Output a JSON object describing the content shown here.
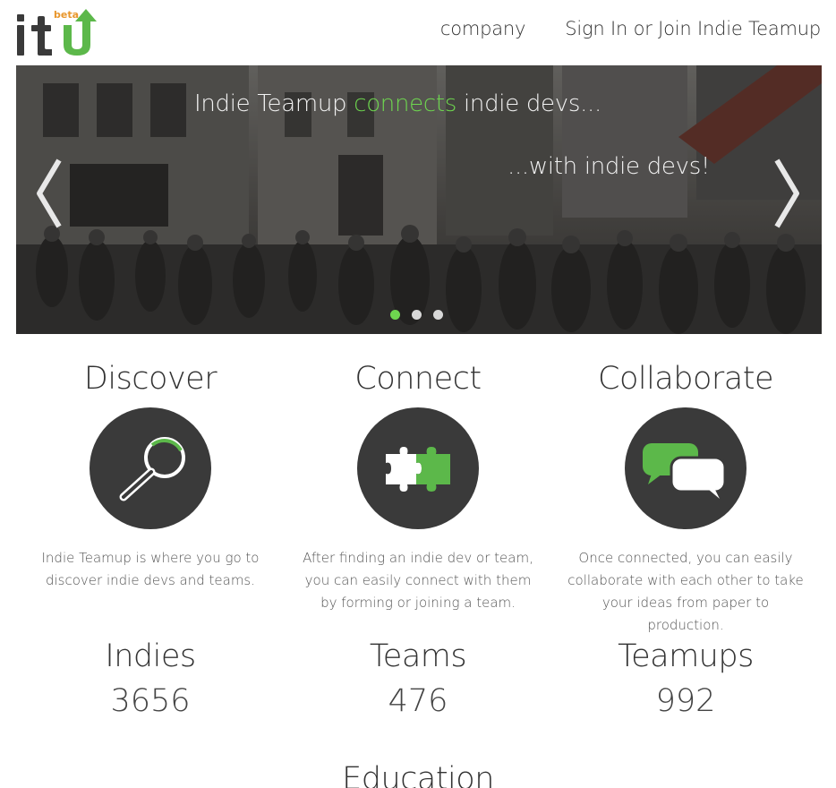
{
  "logo": {
    "text": "itu",
    "badge": "beta"
  },
  "nav": [
    {
      "label": "company"
    },
    {
      "label": "Sign In or Join Indie Teamup"
    }
  ],
  "hero": {
    "line1_pre": "Indie Teamup ",
    "line1_accent": "connects",
    "line1_post": " indie devs...",
    "line2": "...with indie devs!",
    "prev_glyph": "❮",
    "next_glyph": "❯",
    "slide_count": 3,
    "active_slide": 0
  },
  "features": [
    {
      "title": "Discover",
      "icon": "magnifier-icon",
      "text": "Indie Teamup is where you go to discover indie devs and teams."
    },
    {
      "title": "Connect",
      "icon": "puzzle-icon",
      "text": "After finding an indie dev or team, you can easily connect with them by forming or joining a team."
    },
    {
      "title": "Collaborate",
      "icon": "chat-bubbles-icon",
      "text": "Once connected, you can easily collaborate with each other to take your ideas from paper to production."
    }
  ],
  "stats": [
    {
      "label": "Indies",
      "value": "3656"
    },
    {
      "label": "Teams",
      "value": "476"
    },
    {
      "label": "Teamups",
      "value": "992"
    }
  ],
  "next_section": {
    "title": "Education"
  },
  "colors": {
    "accent": "#6ed64f",
    "logo_orange": "#e8962c",
    "icon_bg": "#3a3a3a"
  }
}
